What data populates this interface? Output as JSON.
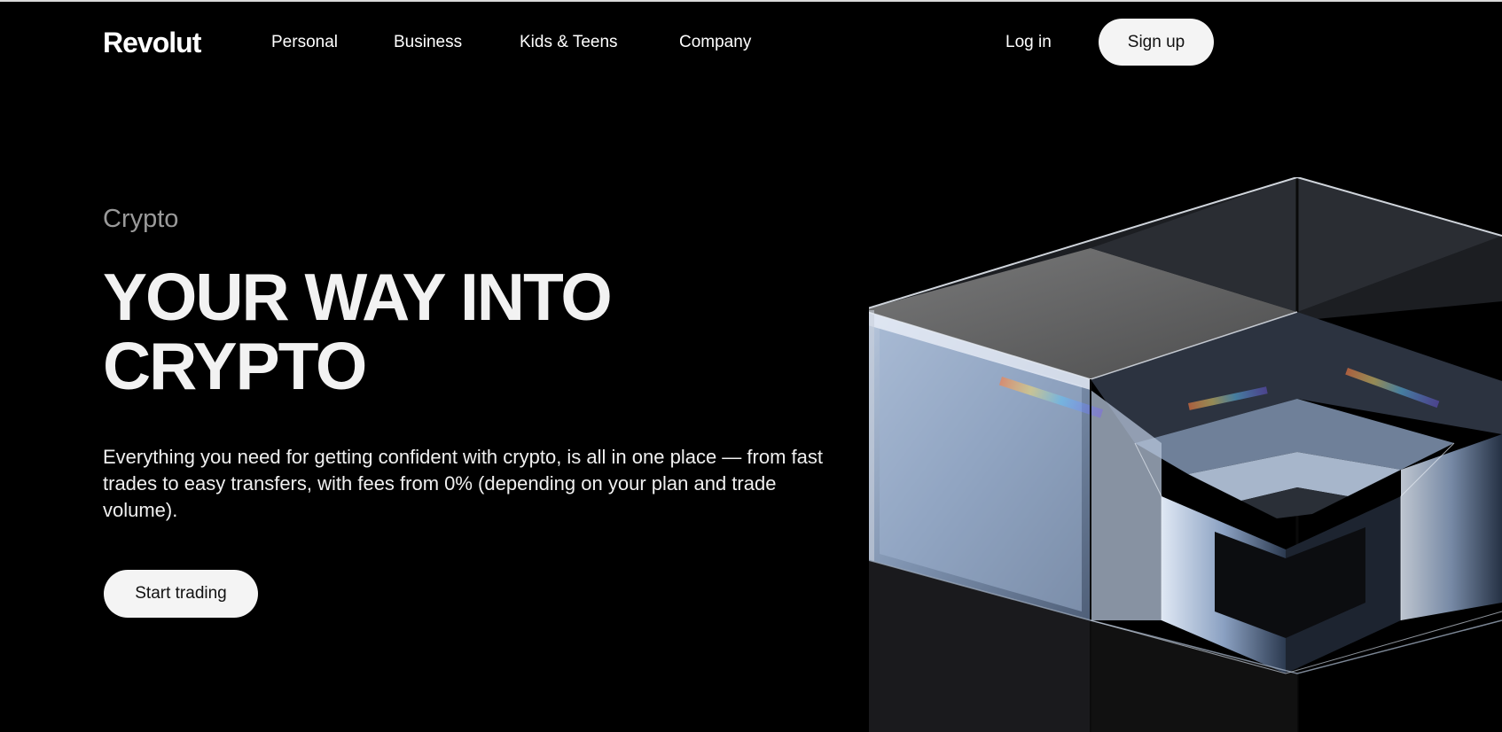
{
  "header": {
    "logo": "Revolut",
    "nav": [
      "Personal",
      "Business",
      "Kids & Teens",
      "Company"
    ],
    "login_label": "Log in",
    "signup_label": "Sign up"
  },
  "hero": {
    "eyebrow": "Crypto",
    "headline_line1": "YOUR WAY INTO",
    "headline_line2": "CRYPTO",
    "description": "Everything you need for getting confident with crypto, is all in one place — from fast trades to easy transfers, with fees from 0% (depending on your plan and trade volume).",
    "cta_label": "Start trading",
    "image": "glass-crypto-cube-illustration"
  },
  "colors": {
    "background": "#000000",
    "button_bg": "#f4f4f4",
    "eyebrow_text": "#9a9a9a"
  }
}
